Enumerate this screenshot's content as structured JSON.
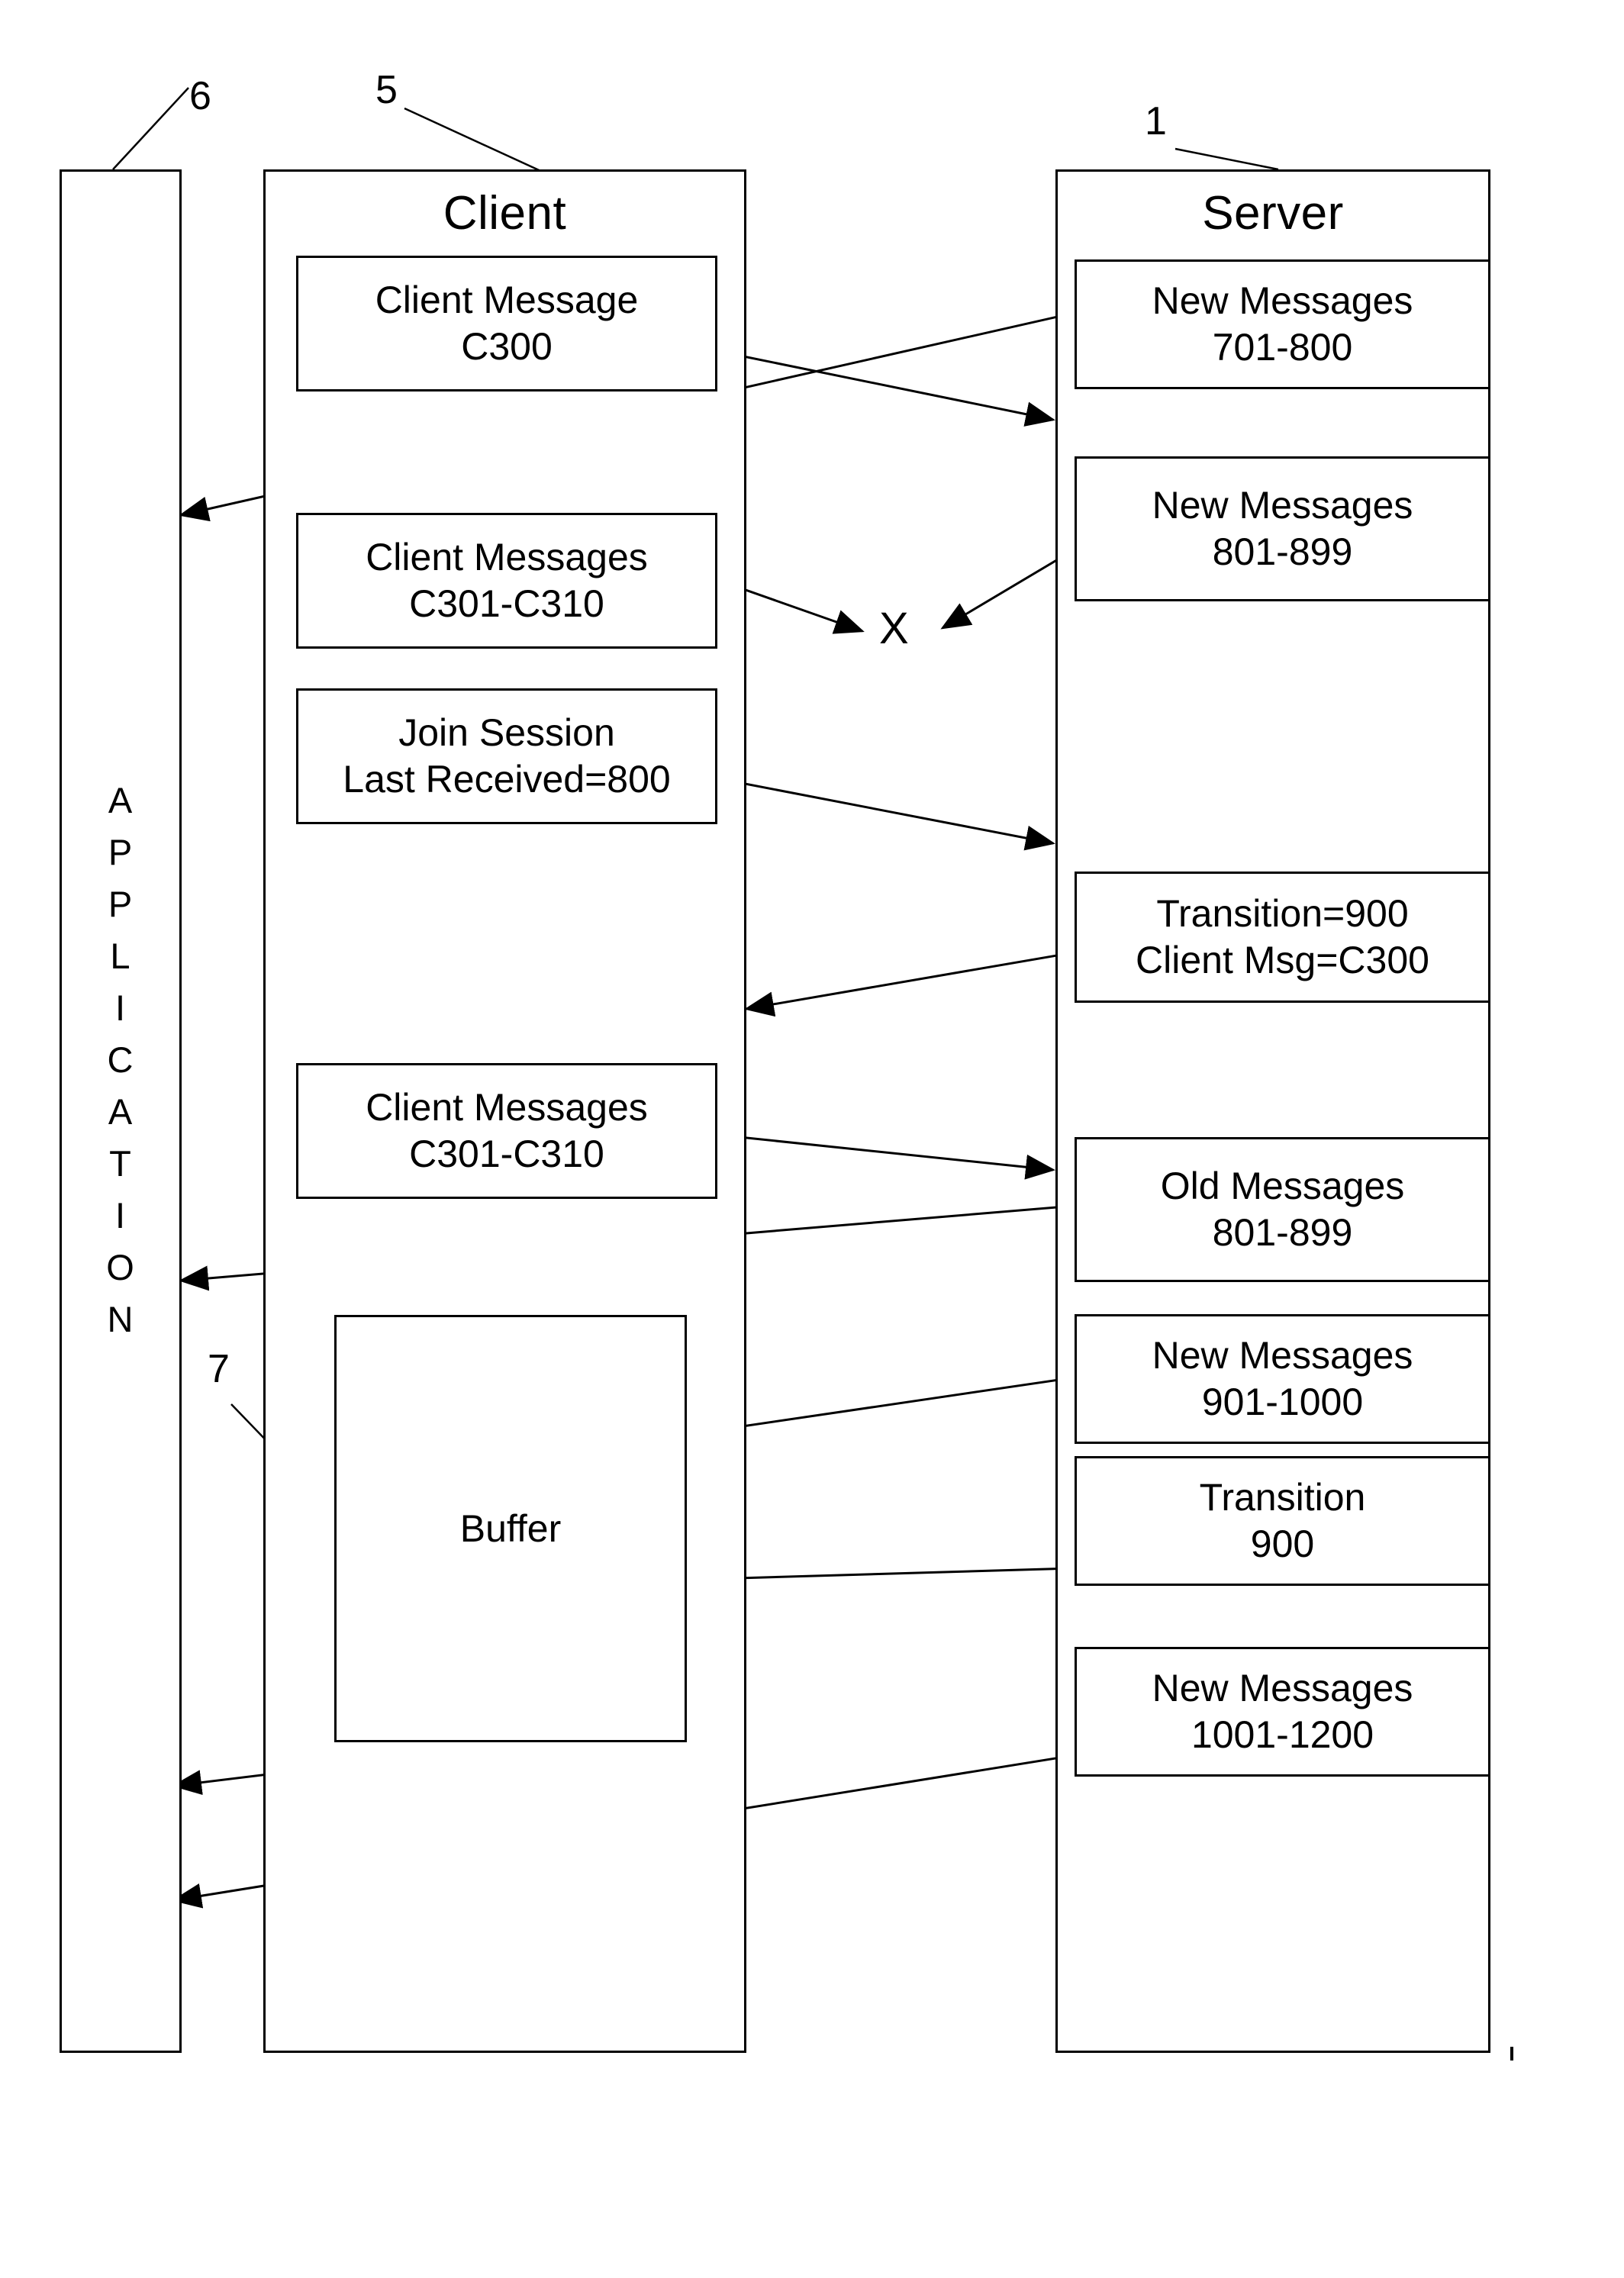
{
  "figure": {
    "type": "patent-sequence-diagram",
    "background_color": "#ffffff",
    "line_color": "#000000"
  },
  "lanes": [
    {
      "id": "application",
      "title": "APPLICATION",
      "reference_numeral": "6",
      "orientation": "vertical-stacked-letters"
    },
    {
      "id": "client",
      "title": "Client",
      "reference_numeral": "5",
      "orientation": "horizontal"
    },
    {
      "id": "server",
      "title": "Server",
      "reference_numeral": "1",
      "orientation": "horizontal"
    }
  ],
  "application": {
    "letters": [
      "A",
      "P",
      "P",
      "L",
      "I",
      "C",
      "A",
      "T",
      "I",
      "O",
      "N"
    ],
    "reference_numeral": "6"
  },
  "client": {
    "title": "Client",
    "reference_numeral": "5",
    "boxes": [
      {
        "id": "client-message-c300",
        "line1": "Client Message",
        "line2": "C300"
      },
      {
        "id": "client-messages-c301-c310-a",
        "line1": "Client Messages",
        "line2": "C301-C310"
      },
      {
        "id": "join-session",
        "line1": "Join Session",
        "line2": "Last Received=800"
      },
      {
        "id": "client-messages-c301-c310-b",
        "line1": "Client Messages",
        "line2": "C301-C310"
      }
    ],
    "buffer": {
      "id": "buffer",
      "label": "Buffer",
      "reference_numeral": "7"
    }
  },
  "server": {
    "title": "Server",
    "reference_numeral": "1",
    "boxes": [
      {
        "id": "new-messages-701-800",
        "line1": "New Messages",
        "line2": "701-800"
      },
      {
        "id": "new-messages-801-899",
        "line1": "New Messages",
        "line2": "801-899"
      },
      {
        "id": "transition-900-client-msg",
        "line1": "Transition=900",
        "line2": "Client Msg=C300"
      },
      {
        "id": "old-messages-801-899",
        "line1": "Old Messages",
        "line2": "801-899"
      },
      {
        "id": "new-messages-901-1000",
        "line1": "New Messages",
        "line2": "901-1000"
      },
      {
        "id": "transition-900",
        "line1": "Transition",
        "line2": "900"
      },
      {
        "id": "new-messages-1001-1200",
        "line1": "New Messages",
        "line2": "1001-1200"
      }
    ]
  },
  "markers": {
    "dropped_message_marker": "X"
  },
  "reference_numerals": [
    "6",
    "5",
    "1",
    "7"
  ]
}
